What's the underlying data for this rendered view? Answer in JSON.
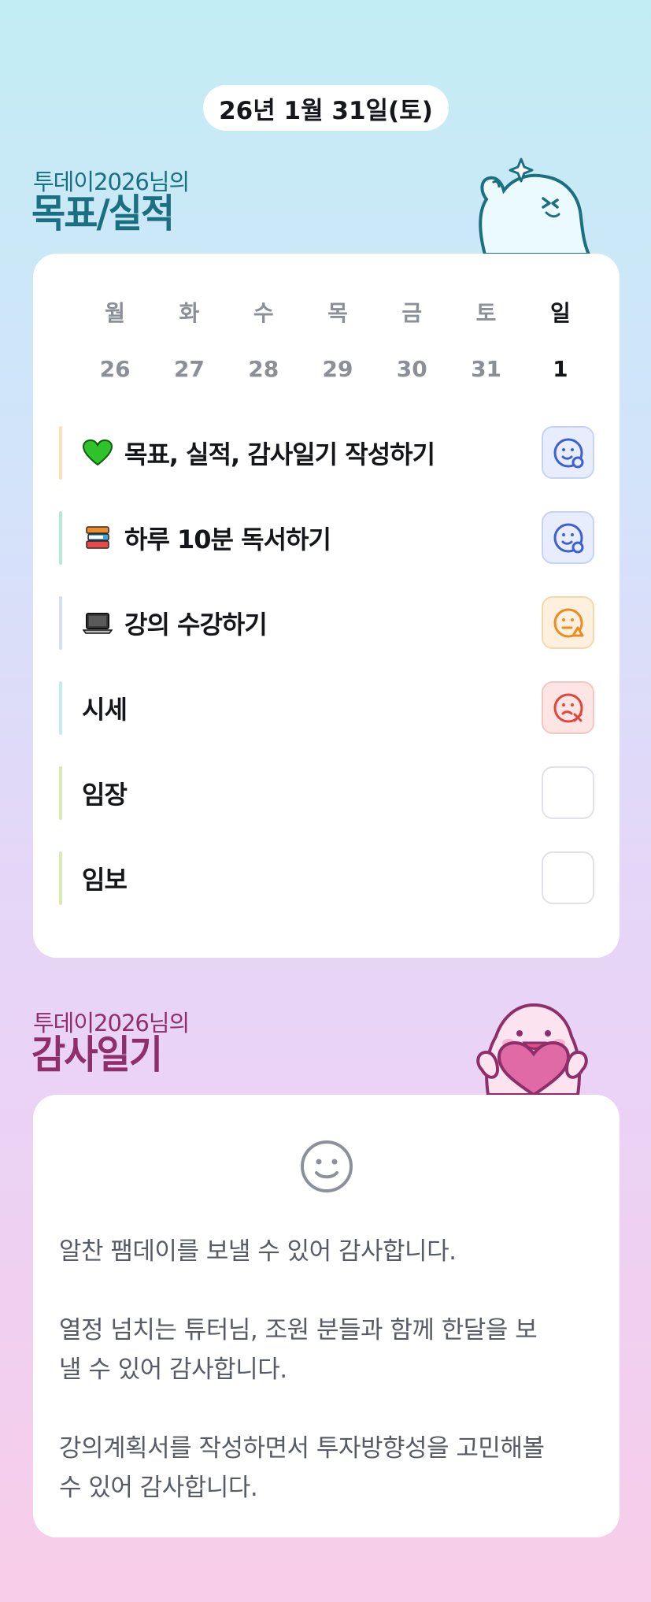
{
  "date": "26년 1월 31일(토)",
  "goals_section": {
    "subtitle": "투데이2026님의",
    "title": "목표/실적"
  },
  "week": {
    "days": [
      "월",
      "화",
      "수",
      "목",
      "금",
      "토",
      "일"
    ],
    "dates": [
      "26",
      "27",
      "28",
      "29",
      "30",
      "31",
      "1"
    ],
    "today_index": 6
  },
  "goals": [
    {
      "label": "목표, 실적, 감사일기 작성하기",
      "emoji": "green-heart-icon",
      "bar_color": "#fde0b7",
      "status": "blue"
    },
    {
      "label": "하루 10분 독서하기",
      "emoji": "books-icon",
      "bar_color": "#b6ead6",
      "status": "blue"
    },
    {
      "label": "강의 수강하기",
      "emoji": "laptop-icon",
      "bar_color": "#d5ddf7",
      "status": "orange"
    },
    {
      "label": "시세",
      "emoji": "",
      "bar_color": "#c3ecf2",
      "status": "red"
    },
    {
      "label": "임장",
      "emoji": "",
      "bar_color": "#d6edb2",
      "status": "empty"
    },
    {
      "label": "임보",
      "emoji": "",
      "bar_color": "#d6edb2",
      "status": "empty"
    }
  ],
  "gratitude_section": {
    "subtitle": "투데이2026님의",
    "title": "감사일기"
  },
  "gratitude": {
    "mood_icon": "smile-icon",
    "entries": [
      "알찬 팸데이를 보낼 수 있어 감사합니다.",
      "열정 넘치는 튜터님, 조원 분들과 함께 한달을 보",
      "낼 수 있어 감사합니다.",
      "강의계획서를 작성하면서 투자방향성을 고민해볼",
      "수 있어 감사합니다."
    ]
  },
  "colors": {
    "teal_title": "#1a6f80",
    "pink_title": "#8e2f6a",
    "status_blue": "#3d5fd6",
    "status_orange": "#ef8a1e",
    "status_red": "#e0463b"
  }
}
